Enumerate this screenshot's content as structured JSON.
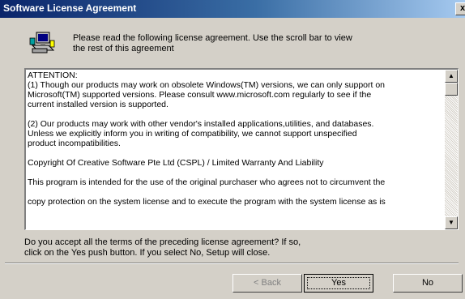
{
  "window": {
    "title": "Software License Agreement",
    "close_label": "x"
  },
  "header": {
    "icon": "setup-computer-icon",
    "text_line1": "Please read the following license agreement. Use the scroll bar to view",
    "text_line2": "the rest of this agreement"
  },
  "license": {
    "lines": [
      "ATTENTION:",
      "(1) Though our products may work on obsolete Windows(TM) versions, we can only support on",
      "Microsoft(TM) supported versions.  Please consult www.microsoft.com regularly to see if the",
      "current installed version is supported.",
      "",
      "(2) Our products may work with other vendor's installed applications,utilities, and databases.",
      "Unless we explicitly inform you in writing of compatibility, we cannot support unspecified",
      "product incompatibilities.",
      "",
      "Copyright Of Creative Software Pte Ltd (CSPL) / Limited Warranty And Liability",
      "",
      "This program is intended for the use of the original purchaser who agrees not to circumvent the",
      "",
      "copy protection on the system license and to execute the program with the system license as is"
    ],
    "scroll_position": 0.0
  },
  "prompt": {
    "line1": "Do you accept all the terms of the preceding license agreement?  If so,",
    "line2": "click on the Yes push button. If you select No, Setup will close."
  },
  "buttons": {
    "back": "< Back",
    "yes": "Yes",
    "no": "No"
  }
}
